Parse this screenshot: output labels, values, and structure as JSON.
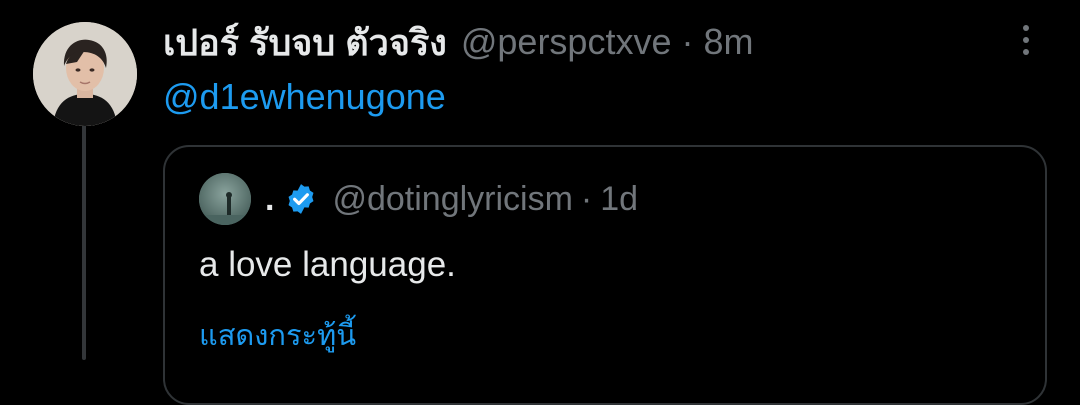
{
  "tweet": {
    "display_name": "เปอร์ รับจบ ตัวจริง",
    "handle": "@perspctxve",
    "separator": "·",
    "time": "8m",
    "mention": "@d1ewhenugone",
    "avatar_icon": "user-avatar-photo",
    "more_icon": "more-vertical-icon"
  },
  "quote": {
    "display_name": ".",
    "handle": "@dotinglyricism",
    "separator": "·",
    "time": "1d",
    "verified": true,
    "verified_icon": "verified-badge-icon",
    "text": "a love language.",
    "translate_label": "แสดงกระทู้นี้"
  },
  "colors": {
    "background": "#000000",
    "primary_text": "#e7e9ea",
    "secondary_text": "#71767b",
    "accent": "#1d9bf0",
    "border": "#2f3336"
  }
}
